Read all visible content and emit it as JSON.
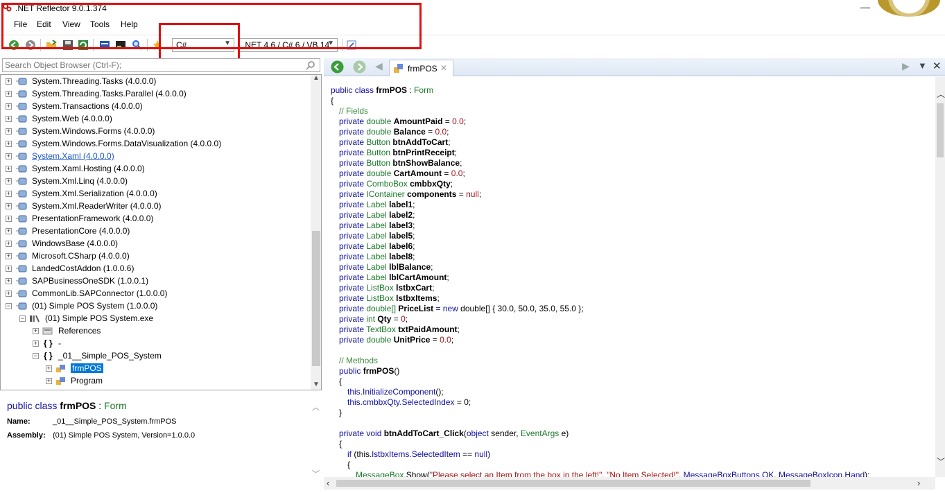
{
  "window": {
    "title": ".NET Reflector 9.0.1.374",
    "minimize_glyph": "—"
  },
  "menu": [
    "File",
    "Edit",
    "View",
    "Tools",
    "Help"
  ],
  "toolbar": {
    "language": "C#",
    "framework": ".NET 4.6 / C# 6 / VB 14"
  },
  "search": {
    "placeholder": "Search Object Browser (Ctrl-F);"
  },
  "tree": {
    "assemblies": [
      "System.Threading.Tasks (4.0.0.0)",
      "System.Threading.Tasks.Parallel (4.0.0.0)",
      "System.Transactions (4.0.0.0)",
      "System.Web (4.0.0.0)",
      "System.Windows.Forms (4.0.0.0)",
      "System.Windows.Forms.DataVisualization (4.0.0.0)",
      "System.Xaml (4.0.0.0)",
      "System.Xaml.Hosting (4.0.0.0)",
      "System.Xml.Linq (4.0.0.0)",
      "System.Xml.Serialization (4.0.0.0)",
      "System.Xml.ReaderWriter (4.0.0.0)",
      "PresentationFramework (4.0.0.0)",
      "PresentationCore (4.0.0.0)",
      "WindowsBase (4.0.0.0)",
      "Microsoft.CSharp (4.0.0.0)",
      "LandedCostAddon (1.0.0.6)",
      "SAPBusinessOneSDK (1.0.0.1)",
      "CommonLib.SAPConnector (1.0.0.0)",
      "(01) Simple POS System (1.0.0.0)"
    ],
    "module": "(01) Simple POS System.exe",
    "references": "References",
    "ns_braces": "{ }",
    "ns_default": "-",
    "ns_app": "_01__Simple_POS_System",
    "type_selected": "frmPOS",
    "type_other": "Program"
  },
  "info": {
    "heading_kw": "public class",
    "heading_name": "frmPOS",
    "heading_sep": ":",
    "heading_base": "Form",
    "name_label": "Name:",
    "name_value": "_01__Simple_POS_System.frmPOS",
    "assembly_label": "Assembly:",
    "assembly_value": "(01) Simple POS System, Version=1.0.0.0"
  },
  "doc_tab": {
    "label": "frmPOS"
  },
  "code": {
    "class_kw": "public class",
    "class_name": "frmPOS",
    "colon": ":",
    "base": "Form",
    "open_brace": "{",
    "close_brace": "}",
    "fields_comment": "// Fields",
    "fields": [
      {
        "kw": "private",
        "type": "double",
        "name": "AmountPaid",
        "init": " = ",
        "val": "0.0",
        "end": ";"
      },
      {
        "kw": "private",
        "type": "double",
        "name": "Balance",
        "init": " = ",
        "val": "0.0",
        "end": ";"
      },
      {
        "kw": "private",
        "type": "Button",
        "name": "btnAddToCart",
        "init": "",
        "val": "",
        "end": ";"
      },
      {
        "kw": "private",
        "type": "Button",
        "name": "btnPrintReceipt",
        "init": "",
        "val": "",
        "end": ";"
      },
      {
        "kw": "private",
        "type": "Button",
        "name": "btnShowBalance",
        "init": "",
        "val": "",
        "end": ";"
      },
      {
        "kw": "private",
        "type": "double",
        "name": "CartAmount",
        "init": " = ",
        "val": "0.0",
        "end": ";"
      },
      {
        "kw": "private",
        "type": "ComboBox",
        "name": "cmbbxQty",
        "init": "",
        "val": "",
        "end": ";"
      },
      {
        "kw": "private",
        "type": "IContainer",
        "name": "components",
        "init": " = ",
        "val": "null",
        "end": ";"
      },
      {
        "kw": "private",
        "type": "Label",
        "name": "label1",
        "init": "",
        "val": "",
        "end": ";"
      },
      {
        "kw": "private",
        "type": "Label",
        "name": "label2",
        "init": "",
        "val": "",
        "end": ";"
      },
      {
        "kw": "private",
        "type": "Label",
        "name": "label3",
        "init": "",
        "val": "",
        "end": ";"
      },
      {
        "kw": "private",
        "type": "Label",
        "name": "label5",
        "init": "",
        "val": "",
        "end": ";"
      },
      {
        "kw": "private",
        "type": "Label",
        "name": "label6",
        "init": "",
        "val": "",
        "end": ";"
      },
      {
        "kw": "private",
        "type": "Label",
        "name": "label8",
        "init": "",
        "val": "",
        "end": ";"
      },
      {
        "kw": "private",
        "type": "Label",
        "name": "lblBalance",
        "init": "",
        "val": "",
        "end": ";"
      },
      {
        "kw": "private",
        "type": "Label",
        "name": "lblCartAmount",
        "init": "",
        "val": "",
        "end": ";"
      },
      {
        "kw": "private",
        "type": "ListBox",
        "name": "lstbxCart",
        "init": "",
        "val": "",
        "end": ";"
      },
      {
        "kw": "private",
        "type": "ListBox",
        "name": "lstbxItems",
        "init": "",
        "val": "",
        "end": ";"
      },
      {
        "kw": "private",
        "type": "double[]",
        "name": "PriceList",
        "init": " = new ",
        "val": "double[] { 30.0, 50.0, 35.0, 55.0 }",
        "end": ";"
      },
      {
        "kw": "private",
        "type": "int",
        "name": "Qty",
        "init": " = ",
        "val": "0",
        "end": ";"
      },
      {
        "kw": "private",
        "type": "TextBox",
        "name": "txtPaidAmount",
        "init": "",
        "val": "",
        "end": ";"
      },
      {
        "kw": "private",
        "type": "double",
        "name": "UnitPrice",
        "init": " = ",
        "val": "0.0",
        "end": ";"
      }
    ],
    "methods_comment": "// Methods",
    "ctor_kw": "public",
    "ctor_name": "frmPOS",
    "ctor_parens": "()",
    "ctor_line1_this": "this.",
    "ctor_line1_call": "InitializeComponent",
    "ctor_line1_end": "();",
    "ctor_line2_this": "this.",
    "ctor_line2_member": "cmbbxQty.SelectedIndex",
    "ctor_line2_end": " = 0;",
    "handler_kw": "private void",
    "handler_name": "btnAddToCart_Click",
    "handler_params_open": "(",
    "handler_p1_type": "object",
    "handler_p1_name": " sender, ",
    "handler_p2_type": "EventArgs",
    "handler_p2_name": " e)",
    "if_kw": "if",
    "if_cond_open": " (this.",
    "if_member": "lstbxItems.SelectedItem",
    "if_rest": " == ",
    "if_null": "null",
    "if_close": ")",
    "msgbox_type": "MessageBox",
    "msgbox_call": ".Show(",
    "msgbox_str1": "\"Please select an Item from the box in the left!\"",
    "msgbox_sep": ", ",
    "msgbox_str2": "\"No Item Selected!\"",
    "msgbox_arg3": "MessageBoxButtons.OK",
    "msgbox_arg4": "MessageBoxIcon.Hand",
    "msgbox_end": ");"
  },
  "colors": {
    "annotation": "#e01010",
    "selection": "#0078d7",
    "keyword": "#1010a0",
    "type": "#1a7a2a",
    "literal": "#a31515"
  }
}
